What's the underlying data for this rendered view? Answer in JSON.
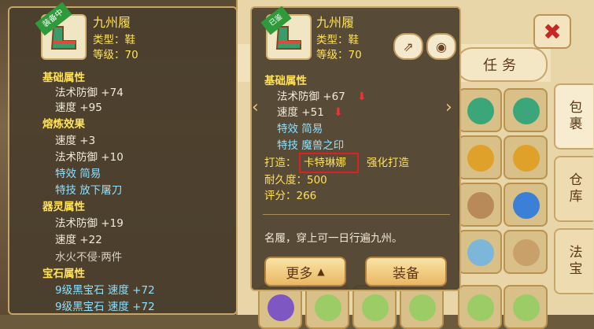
{
  "left_tooltip": {
    "badge": "装备中",
    "name": "九州履",
    "type_line": "类型：鞋",
    "level_line": "等级：70",
    "base_header": "基础属性",
    "base": [
      "法术防御 +74",
      "速度 +95"
    ],
    "refine_header": "熔炼效果",
    "refine": [
      "速度 +3",
      "法术防御 +10"
    ],
    "refine_special": [
      "特效 简易",
      "特技 放下屠刀"
    ],
    "spirit_header": "器灵属性",
    "spirit": [
      "法术防御 +19",
      "速度 +22"
    ],
    "spirit_extra": "水火不侵·两件",
    "gem_header": "宝石属性",
    "gems": [
      "9级黑宝石  速度 +72",
      "9级黑宝石  速度 +72"
    ]
  },
  "right_tooltip": {
    "badge": "已鉴",
    "name": "九州履",
    "type_line": "类型：鞋",
    "level_line": "等级：70",
    "base_header": "基础属性",
    "base": [
      "法术防御 +67",
      "速度 +51"
    ],
    "special": [
      "特效 简易",
      "特技 魔兽之印"
    ],
    "maker_label": "打造：",
    "maker_name": "卡特琳娜",
    "maker_type": "强化打造",
    "durability": "耐久度：500",
    "score": "评分：266",
    "description": "名履，穿上可一日行遍九州。",
    "more_button": "更多",
    "equip_button": "装备"
  },
  "inventory": {
    "header_tab": "任务",
    "side_tabs": [
      "包裹",
      "仓库",
      "法宝"
    ]
  },
  "colors": {
    "accent": "#ffe15a",
    "highlight": "#e02020",
    "panel": "#4a3e2c"
  }
}
